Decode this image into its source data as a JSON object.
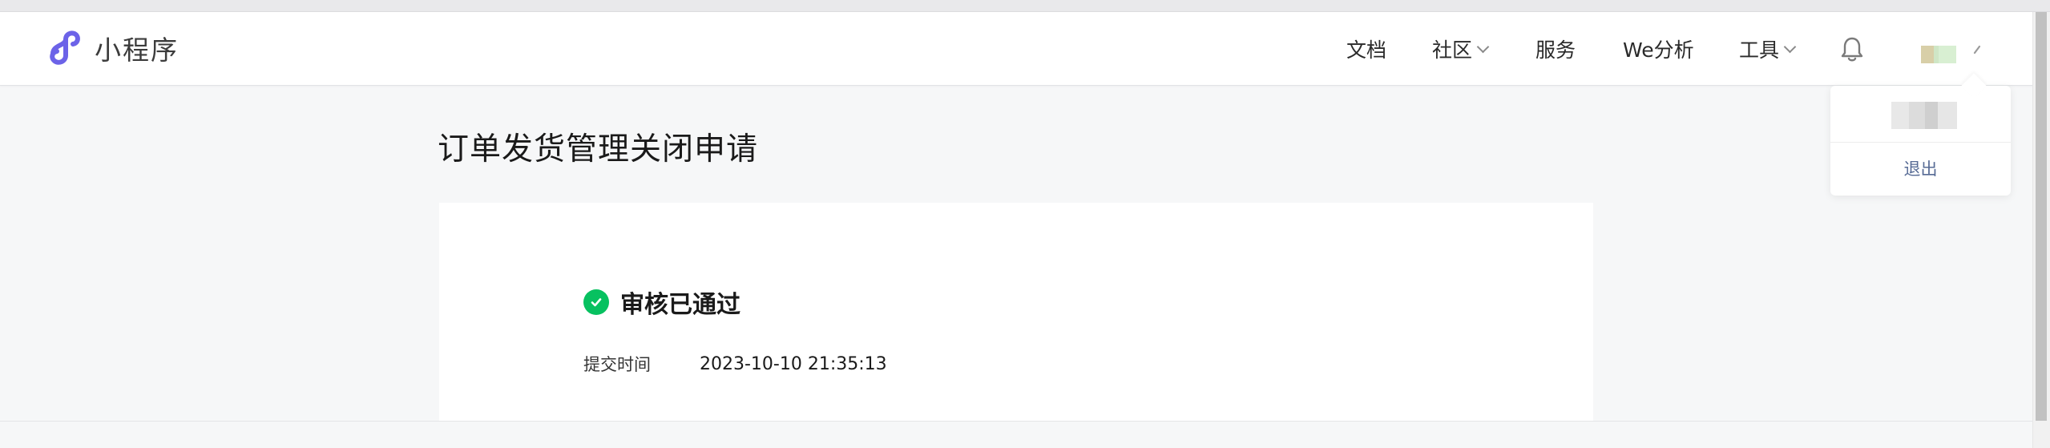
{
  "header": {
    "logo_text": "小程序",
    "nav": [
      {
        "label": "文档",
        "has_dropdown": false
      },
      {
        "label": "社区",
        "has_dropdown": true
      },
      {
        "label": "服务",
        "has_dropdown": false
      },
      {
        "label": "We分析",
        "has_dropdown": false
      },
      {
        "label": "工具",
        "has_dropdown": true
      }
    ],
    "icons": {
      "bell": "bell-icon",
      "dropdown": "chevron-down-icon"
    }
  },
  "user_menu": {
    "logout_label": "退出"
  },
  "page": {
    "title": "订单发货管理关闭申请"
  },
  "result": {
    "status_text": "审核已通过",
    "status_color": "#07c160",
    "submit_time_label": "提交时间",
    "submit_time_value": "2023-10-10 21:35:13"
  }
}
